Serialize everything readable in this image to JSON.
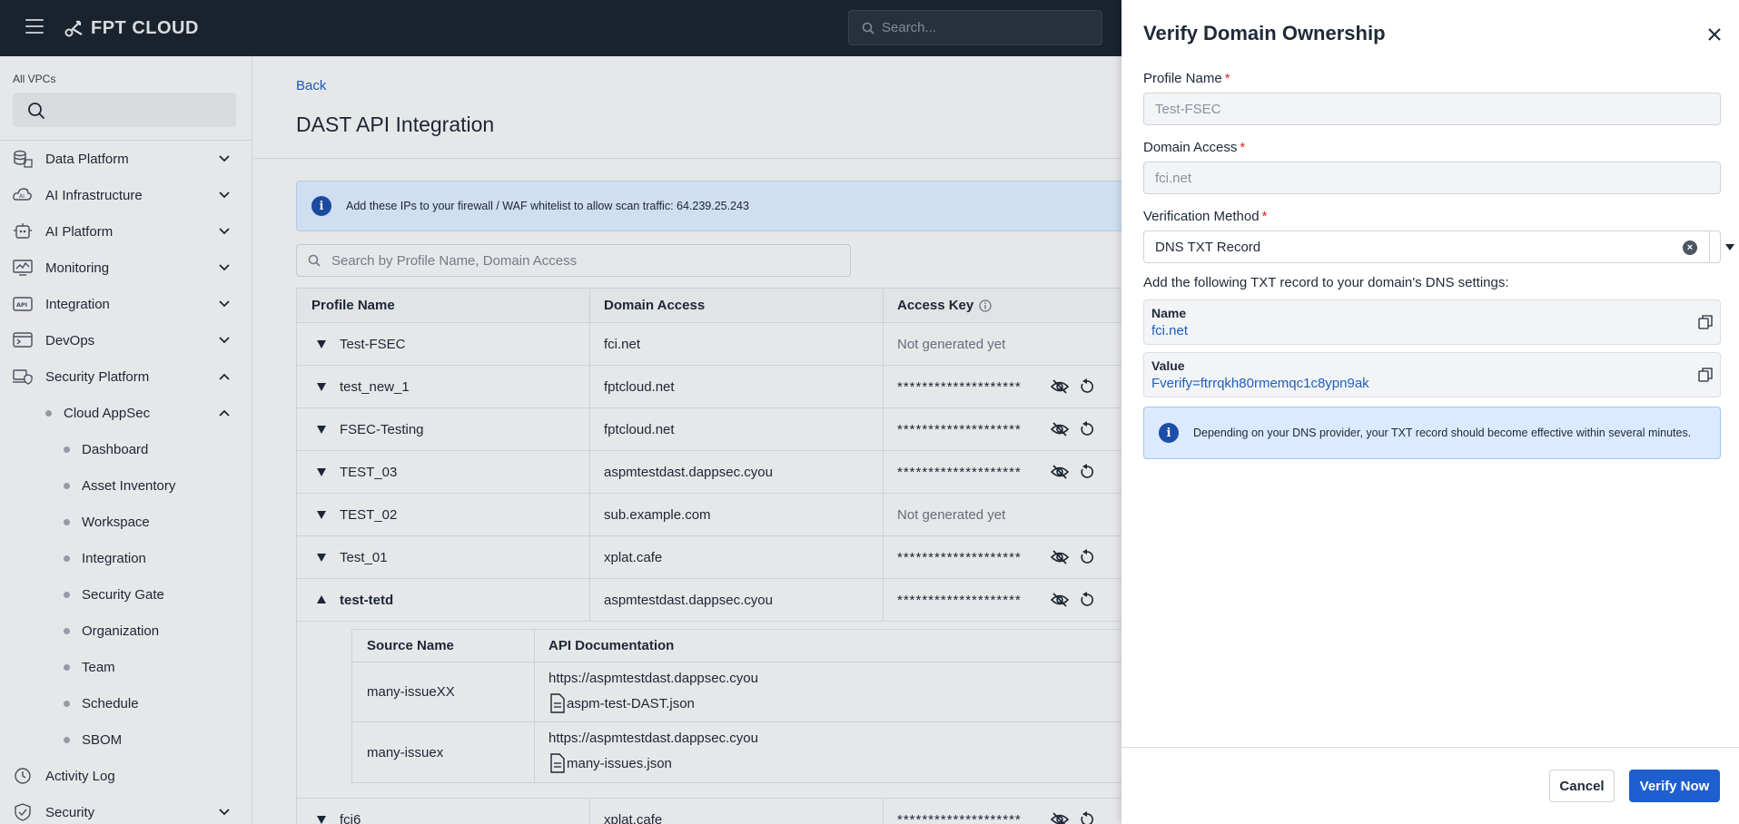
{
  "topbar": {
    "brand": "FPT CLOUD",
    "search_placeholder": "Search..."
  },
  "sidebar": {
    "vpc_label": "All VPCs",
    "items": [
      {
        "label": "Data Platform",
        "icon": "database-icon",
        "expanded": false
      },
      {
        "label": "AI Infrastructure",
        "icon": "cloud-ai-icon",
        "expanded": false
      },
      {
        "label": "AI Platform",
        "icon": "robot-icon",
        "expanded": false
      },
      {
        "label": "Monitoring",
        "icon": "monitor-chart-icon",
        "expanded": false
      },
      {
        "label": "Integration",
        "icon": "api-icon",
        "expanded": false
      },
      {
        "label": "DevOps",
        "icon": "devops-icon",
        "expanded": false
      },
      {
        "label": "Security Platform",
        "icon": "shield-laptop-icon",
        "expanded": true
      }
    ],
    "cloud_appsec": {
      "label": "Cloud AppSec",
      "expanded": true
    },
    "appsec_items": [
      "Dashboard",
      "Asset Inventory",
      "Workspace",
      "Integration",
      "Security Gate",
      "Organization",
      "Team",
      "Schedule",
      "SBOM"
    ],
    "activity_log": "Activity Log",
    "security": "Security"
  },
  "main": {
    "back_label": "Back",
    "title": "DAST API Integration",
    "banner_text": "Add these IPs to your firewall / WAF whitelist to allow scan traffic: 64.239.25.243",
    "table_search_placeholder": "Search by Profile Name, Domain Access",
    "columns": [
      "Profile Name",
      "Domain Access",
      "Access Key"
    ],
    "rows": [
      {
        "name": "Test-FSEC",
        "domain": "fci.net",
        "key": "Not generated yet",
        "generated": false
      },
      {
        "name": "test_new_1",
        "domain": "fptcloud.net",
        "key": "********************",
        "generated": true
      },
      {
        "name": "FSEC-Testing",
        "domain": "fptcloud.net",
        "key": "********************",
        "generated": true
      },
      {
        "name": "TEST_03",
        "domain": "aspmtestdast.dappsec.cyou",
        "key": "********************",
        "generated": true
      },
      {
        "name": "TEST_02",
        "domain": "sub.example.com",
        "key": "Not generated yet",
        "generated": false
      },
      {
        "name": "Test_01",
        "domain": "xplat.cafe",
        "key": "********************",
        "generated": true
      },
      {
        "name": "test-tetd",
        "domain": "aspmtestdast.dappsec.cyou",
        "key": "********************",
        "generated": true,
        "expanded": true
      }
    ],
    "sub_columns": [
      "Source Name",
      "API Documentation"
    ],
    "sub_rows": [
      {
        "source": "many-issueXX",
        "url": "https://aspmtestdast.dappsec.cyou",
        "file": "aspm-test-DAST.json"
      },
      {
        "source": "many-issuex",
        "url": "https://aspmtestdast.dappsec.cyou",
        "file": "many-issues.json"
      }
    ],
    "last_row": {
      "name": "fci6",
      "domain": "xplat.cafe",
      "key": "********************"
    }
  },
  "drawer": {
    "title": "Verify Domain Ownership",
    "profile_label": "Profile Name",
    "profile_value": "Test-FSEC",
    "domain_label": "Domain Access",
    "domain_value": "fci.net",
    "method_label": "Verification Method",
    "method_value": "DNS TXT Record",
    "helper": "Add the following TXT record to your domain's DNS settings:",
    "record_name_key": "Name",
    "record_name_value": "fci.net",
    "record_value_key": "Value",
    "record_value_value": "Fverify=ftrrqkh80rmemqc1c8ypn9ak",
    "note": "Depending on your DNS provider, your TXT record should become effective within several minutes.",
    "cancel_label": "Cancel",
    "verify_label": "Verify Now"
  },
  "colors": {
    "topbar": "#1b2430",
    "accent": "#1d5fce",
    "link": "#1d5fbf",
    "required": "#dc2626"
  }
}
